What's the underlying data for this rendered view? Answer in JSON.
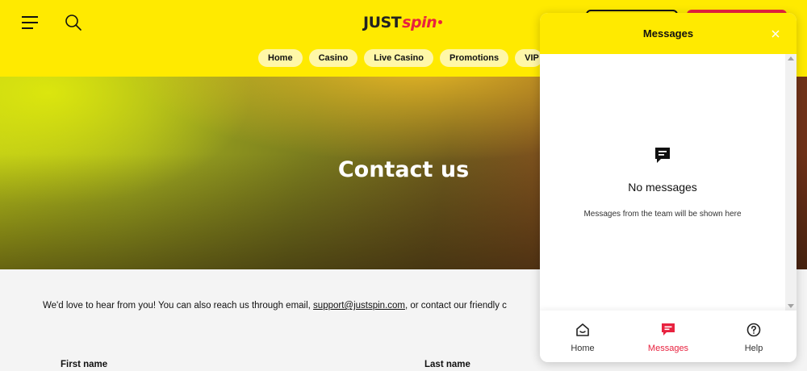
{
  "header": {
    "logo_text_just": "JUST",
    "logo_text_spin": "spin",
    "nav": [
      "Home",
      "Casino",
      "Live Casino",
      "Promotions",
      "VIP"
    ]
  },
  "hero": {
    "title": "Contact us"
  },
  "content": {
    "intro_before": "We'd love to hear from you! You can also reach us through email, ",
    "email": "support@justspin.com",
    "intro_after": ", or contact our friendly c",
    "first_name_label": "First name",
    "last_name_label": "Last name"
  },
  "messages_panel": {
    "title": "Messages",
    "empty_title": "No messages",
    "empty_subtitle": "Messages from the team will be shown here",
    "tabs": [
      {
        "label": "Home",
        "icon": "home-icon",
        "active": false
      },
      {
        "label": "Messages",
        "icon": "messages-icon",
        "active": true
      },
      {
        "label": "Help",
        "icon": "help-icon",
        "active": false
      }
    ]
  },
  "colors": {
    "brand_yellow": "#ffea00",
    "brand_red": "#e8223f"
  }
}
